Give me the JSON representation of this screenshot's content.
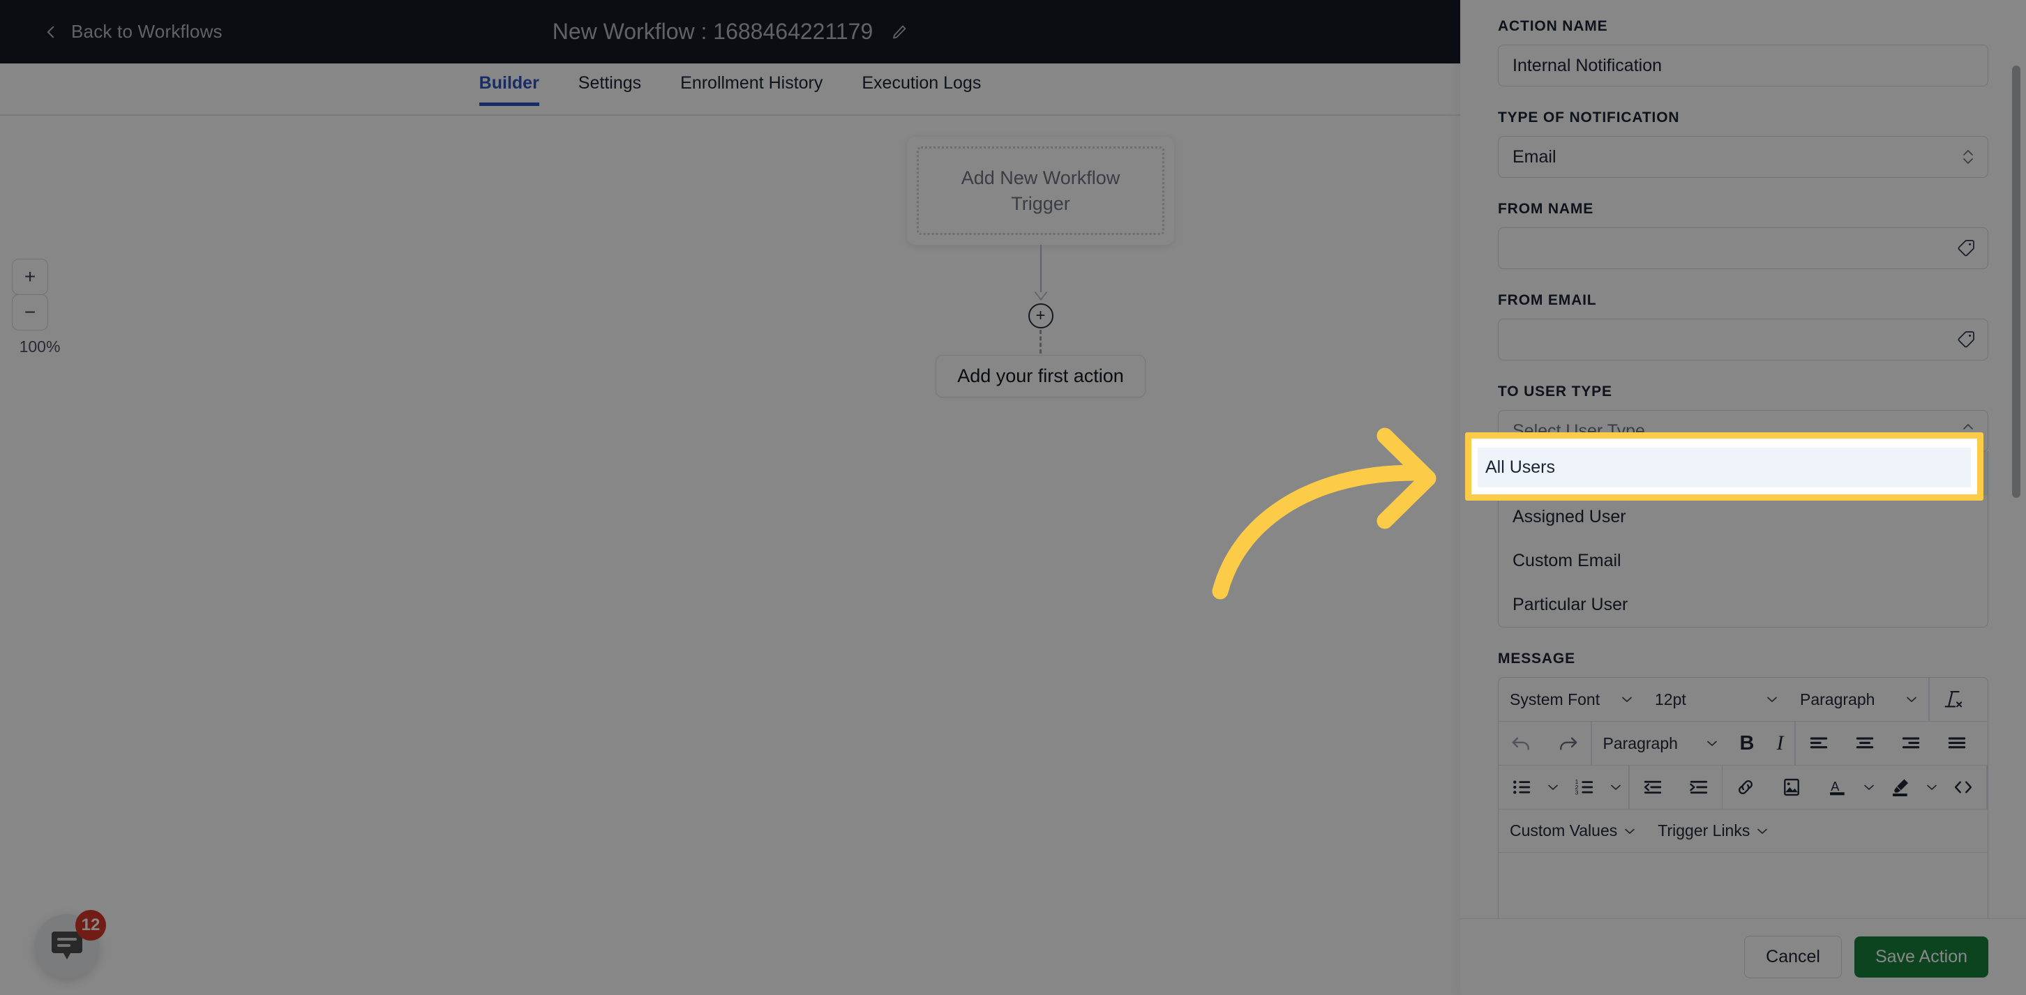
{
  "header": {
    "back_label": "Back to Workflows",
    "workflow_title": "New Workflow : 1688464221179",
    "edit_icon": "pencil-icon"
  },
  "tabs": [
    {
      "label": "Builder",
      "active": true
    },
    {
      "label": "Settings",
      "active": false
    },
    {
      "label": "Enrollment History",
      "active": false
    },
    {
      "label": "Execution Logs",
      "active": false
    }
  ],
  "canvas": {
    "zoom_in_label": "+",
    "zoom_out_label": "−",
    "zoom_level": "100%",
    "trigger_text": "Add New Workflow Trigger",
    "plus_label": "+",
    "first_action_label": "Add your first action"
  },
  "chat": {
    "badge_count": "12",
    "icon": "chat-bubble-icon"
  },
  "panel": {
    "action_name": {
      "label": "ACTION NAME",
      "value": "Internal Notification",
      "placeholder": ""
    },
    "type_of_notification": {
      "label": "TYPE OF NOTIFICATION",
      "value": "Email"
    },
    "from_name": {
      "label": "FROM NAME",
      "value": "",
      "placeholder": "",
      "trailing_icon": "tag-icon"
    },
    "from_email": {
      "label": "FROM EMAIL",
      "value": "",
      "placeholder": "",
      "trailing_icon": "tag-icon"
    },
    "to_user_type": {
      "label": "TO USER TYPE",
      "placeholder": "Select User Type",
      "value": "",
      "open": true,
      "options": [
        "All Users",
        "Assigned User",
        "Custom Email",
        "Particular User"
      ],
      "highlighted_option": "All Users"
    },
    "message": {
      "label": "MESSAGE",
      "toolbar_row1": [
        {
          "label": "System Font",
          "icon": "chevron-down-icon"
        },
        {
          "label": "12pt",
          "icon": "chevron-down-icon"
        },
        {
          "label": "Paragraph",
          "icon": "chevron-down-icon"
        },
        {
          "label": "",
          "icon": "clear-formatting-icon"
        }
      ],
      "toolbar_row2": [
        {
          "label": "",
          "icon": "undo-icon"
        },
        {
          "label": "",
          "icon": "redo-icon"
        },
        {
          "label": "Paragraph",
          "icon": "chevron-down-icon"
        },
        {
          "label": "B",
          "icon": "bold-icon"
        },
        {
          "label": "I",
          "icon": "italic-icon"
        },
        {
          "label": "",
          "icon": "align-left-icon"
        },
        {
          "label": "",
          "icon": "align-center-icon"
        },
        {
          "label": "",
          "icon": "align-right-icon"
        },
        {
          "label": "",
          "icon": "align-justify-icon"
        }
      ],
      "toolbar_row3": [
        {
          "label": "",
          "icon": "bulleted-list-icon"
        },
        {
          "label": "",
          "icon": "chevron-down-icon"
        },
        {
          "label": "",
          "icon": "numbered-list-icon"
        },
        {
          "label": "",
          "icon": "chevron-down-icon"
        },
        {
          "label": "",
          "icon": "outdent-icon"
        },
        {
          "label": "",
          "icon": "indent-icon"
        },
        {
          "label": "",
          "icon": "link-icon"
        },
        {
          "label": "",
          "icon": "image-icon"
        },
        {
          "label": "",
          "icon": "text-color-icon"
        },
        {
          "label": "",
          "icon": "chevron-down-icon"
        },
        {
          "label": "",
          "icon": "highlight-color-icon"
        },
        {
          "label": "",
          "icon": "chevron-down-icon"
        },
        {
          "label": "",
          "icon": "source-code-icon"
        }
      ],
      "toolbar_row4": [
        {
          "label": "Custom Values",
          "icon": "chevron-down-icon"
        },
        {
          "label": "Trigger Links",
          "icon": "chevron-down-icon"
        }
      ],
      "body_value": ""
    },
    "footer": {
      "cancel_label": "Cancel",
      "save_label": "Save Action"
    }
  },
  "annotation": {
    "arrow_color": "#fccb47",
    "highlight_color": "#fccb47",
    "highlight_target": "All Users"
  },
  "colors": {
    "topbar_bg": "#151a25",
    "accent_tab": "#2a55c4",
    "save_green": "#16803c",
    "badge_red": "#d8362a",
    "dim_overlay": "rgba(0,0,0,0.47)"
  }
}
